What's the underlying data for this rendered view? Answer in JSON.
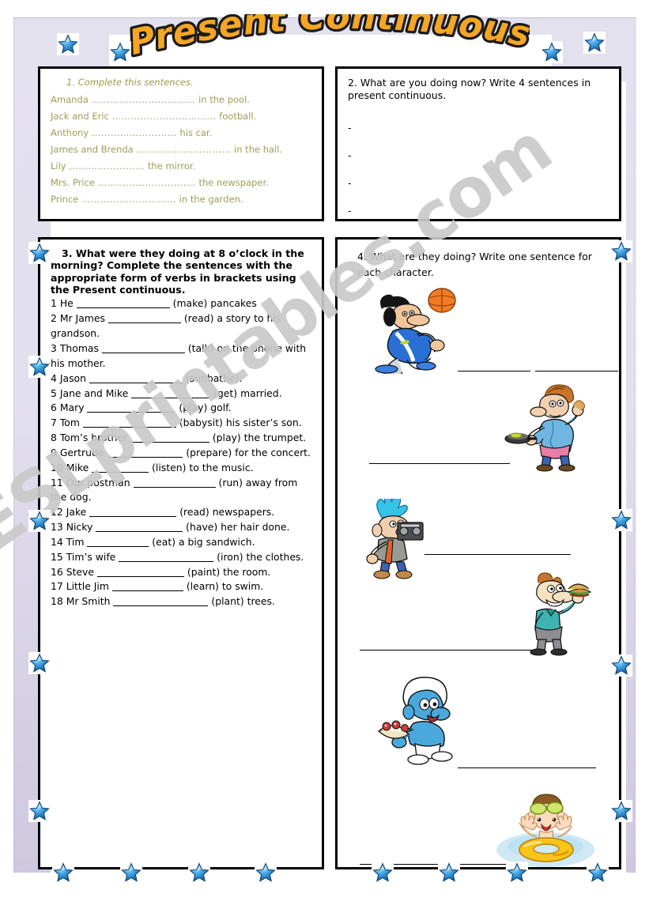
{
  "title": "Present Continuous",
  "watermark": "ESLprintables.com",
  "colors": {
    "title_fill": "#f5a623",
    "title_outline": "#1b1b1b",
    "border_frame": "#cfc8e0",
    "ex1_text": "#9d9d57",
    "box_border": "#000000",
    "star": "#2a8fd8",
    "watermark": "#c9c9c9"
  },
  "exercise1": {
    "heading": "1.    Complete this sentences.",
    "lines": [
      {
        "subject": "Amanda",
        "dots": "……………………………",
        "tail": "in the pool."
      },
      {
        "subject": "Jack and Eric",
        "dots": "……………………………",
        "tail": "football."
      },
      {
        "subject": "Anthony",
        "dots": "………………………",
        "tail": "his car."
      },
      {
        "subject": "James and Brenda",
        "dots": "…………………………",
        "tail": "in the hall."
      },
      {
        "subject": "Lily",
        "dots": "……………………",
        "tail": "the mirror."
      },
      {
        "subject": "Mrs. Price",
        "dots": "………………………….",
        "tail": "the newspaper."
      },
      {
        "subject": "Prince",
        "dots": "…………………………",
        "tail": "in the garden."
      }
    ]
  },
  "exercise2": {
    "heading": "2. What are you doing now? Write 4 sentences in present continuous.",
    "dashes": [
      "-",
      "-",
      "-",
      "-"
    ]
  },
  "exercise3": {
    "heading": "3. What were they doing at 8 o’clock in the morning? Complete the sentences with the appropriate form of verbs in brackets using the Present continuous.",
    "items": [
      {
        "num": "1",
        "before": "He",
        "blank_w": 118,
        "after": "(make) pancakes"
      },
      {
        "num": "2",
        "before": "Mr James",
        "blank_w": 92,
        "after": "(read) a story to his grandson."
      },
      {
        "num": "3",
        "before": "Thomas",
        "blank_w": 105,
        "after": "(talk) on the phone with his mother."
      },
      {
        "num": "4",
        "before": "Jason",
        "blank_w": 118,
        "after": "(sunbathe)."
      },
      {
        "num": "5",
        "before": "Jane and Mike",
        "blank_w": 100,
        "after": "(get) married."
      },
      {
        "num": "6",
        "before": "Mary",
        "blank_w": 112,
        "after": "(play) golf."
      },
      {
        "num": "7",
        "before": "Tom",
        "blank_w": 118,
        "after": "(babysit) his sister’s son."
      },
      {
        "num": "8",
        "before": "Tom’s brother",
        "blank_w": 100,
        "after": "(play) the trumpet."
      },
      {
        "num": "9",
        "before": "Gertrude",
        "blank_w": 96,
        "after": "(prepare) for the concert."
      },
      {
        "num": "10",
        "before": "Mike",
        "blank_w": 72,
        "after": "(listen) to the music."
      },
      {
        "num": "11",
        "before": "Our postman",
        "blank_w": 104,
        "after": "(run) away from the dog."
      },
      {
        "num": "12",
        "before": "Jake",
        "blank_w": 110,
        "after": "(read) newspapers."
      },
      {
        "num": "13",
        "before": "Nicky",
        "blank_w": 110,
        "after": "(have) her hair done."
      },
      {
        "num": "14",
        "before": "Tim",
        "blank_w": 78,
        "after": "(eat) a big sandwich."
      },
      {
        "num": "15",
        "before": "Tim’s wife",
        "blank_w": 120,
        "after": "(iron) the clothes."
      },
      {
        "num": "16",
        "before": "Steve",
        "blank_w": 110,
        "after": "(paint) the room."
      },
      {
        "num": "17",
        "before": "Little Jim",
        "blank_w": 90,
        "after": "(learn) to swim."
      },
      {
        "num": "18",
        "before": "Mr Smith",
        "blank_w": 120,
        "after": "(plant) trees."
      }
    ]
  },
  "exercise4": {
    "heading": "4. What are they doing? Write one sentence for each character.",
    "characters": [
      {
        "name": "goofy-playing-basketball"
      },
      {
        "name": "man-cooking-frying-pan"
      },
      {
        "name": "boy-carrying-boombox"
      },
      {
        "name": "waiter-carrying-hamburger"
      },
      {
        "name": "smurf-carrying-cake"
      },
      {
        "name": "boy-swimming-float-ring"
      }
    ],
    "answer_lines": 6
  }
}
